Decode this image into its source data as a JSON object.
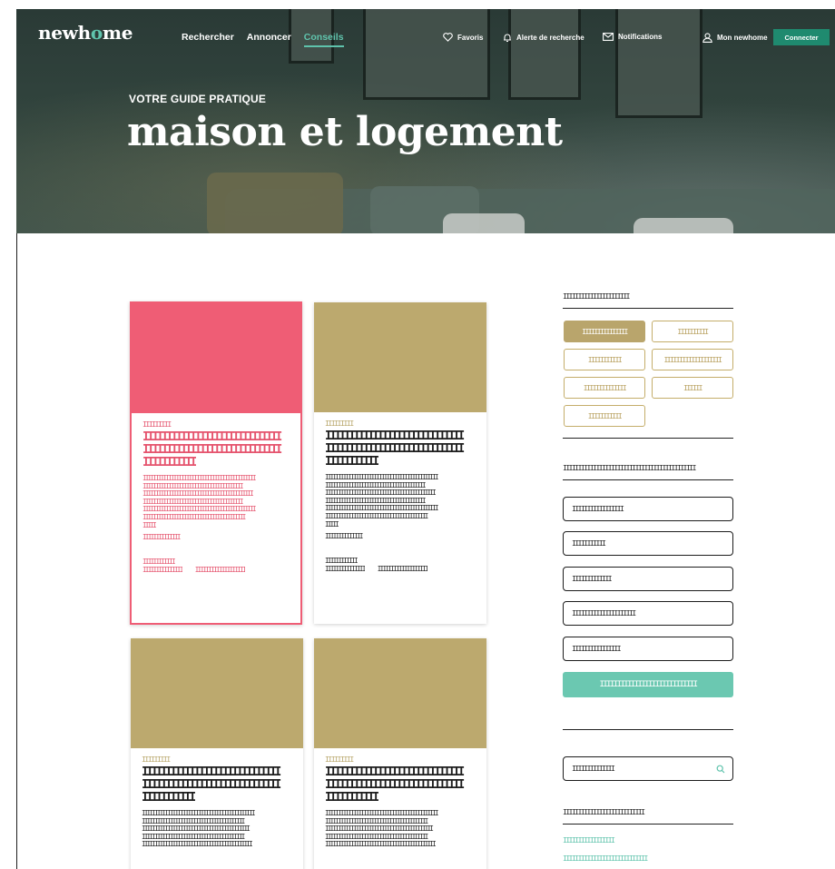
{
  "header": {
    "logo_before": "newh",
    "logo_mark": "o",
    "logo_after": "me",
    "nav": [
      "Rechercher",
      "Annoncer",
      "Conseils"
    ],
    "active_nav": "Conseils",
    "favoris": "Favoris",
    "alerte": "Alerte de recherche",
    "notifications": "Notifications",
    "account": "Mon newhome",
    "connect": "Connecter",
    "icons": {
      "favoris": "heart-icon",
      "alerte": "bell-icon",
      "notifications": "envelope-icon",
      "account": "user-icon"
    }
  },
  "hero": {
    "kicker": "VOTRE GUIDE PRATIQUE",
    "title": "maison et logement"
  },
  "cards": [
    {
      "category": "IIIIIIIII",
      "title_lines": [
        "IIIIIIIIIIIIIIIIIIIIIIIIIIIII",
        "IIIIIIIIIIIIIIIIIIIIIIIIIIIII",
        "IIIIIIIIIII"
      ],
      "excerpt_lines": [
        "IIIIIIIIIIIIIIIIIIIIIIIIIIIIIIIIIIIIIIIIIIII",
        "IIIIIIIIIIIIIIIIIIIIIIIIIIIIIIIIIIIIIII",
        "IIIIIIIIIIIIIIIIIIIIIIIIIIIIIIIIIIIIIIIIIII",
        "IIIIIIIIIIIIIIIIIIIIIIIIIIIIIIIIIIIIIII",
        "IIIIIIIIIIIIIIIIIIIIIIIIIIIIIIIIIIIIIIIIIIII",
        "IIIIIIIIIIIIIIIIIIIIIIIIIIIIIIIIIIIIIIII",
        "IIIII"
      ],
      "more": "IIIIIIIIIIIIII",
      "meta_line1": "IIIIIIIIIIII",
      "meta_date": "IIIIIIIIIIIIIII",
      "meta_read": "IIIIIIIIIIIIIIIIIII"
    },
    {
      "category": "IIIIIIIII",
      "title_lines": [
        "IIIIIIIIIIIIIIIIIIIIIIIIIIIII",
        "IIIIIIIIIIIIIIIIIIIIIIIIIIIII",
        "IIIIIIIIIII"
      ],
      "excerpt_lines": [
        "IIIIIIIIIIIIIIIIIIIIIIIIIIIIIIIIIIIIIIIIIIII",
        "IIIIIIIIIIIIIIIIIIIIIIIIIIIIIIIIIIIIIII",
        "IIIIIIIIIIIIIIIIIIIIIIIIIIIIIIIIIIIIIIIIIII",
        "IIIIIIIIIIIIIIIIIIIIIIIIIIIIIIIIIIIIIII",
        "IIIIIIIIIIIIIIIIIIIIIIIIIIIIIIIIIIIIIIIIIIII",
        "IIIIIIIIIIIIIIIIIIIIIIIIIIIIIIIIIIIIIIII",
        "IIIII"
      ],
      "more": "IIIIIIIIIIIIII",
      "meta_line1": "IIIIIIIIIIII",
      "meta_date": "IIIIIIIIIIIIIII",
      "meta_read": "IIIIIIIIIIIIIIIIIII"
    },
    {
      "category": "IIIIIIIII",
      "title_lines": [
        "IIIIIIIIIIIIIIIIIIIIIIIIIIIII",
        "IIIIIIIIIIIIIIIIIIIIIIIIIIIII",
        "IIIIIIIIIII"
      ],
      "excerpt_lines": [
        "IIIIIIIIIIIIIIIIIIIIIIIIIIIIIIIIIIIIIIIIIIII",
        "IIIIIIIIIIIIIIIIIIIIIIIIIIIIIIIIIIIIIIII",
        "IIIIIIIIIIIIIIIIIIIIIIIIIIIIIIIIIIIIIIIIII",
        "IIIIIIIIIIIIIIIIIIIIIIIIIIIIIIIIIIIIIIII",
        "IIIIIIIIIIIIIIIIIIIIIIIIIIIIIIIIIIIIIIIIIII"
      ]
    },
    {
      "category": "IIIIIIIII",
      "title_lines": [
        "IIIIIIIIIIIIIIIIIIIIIIIIIIIII",
        "IIIIIIIIIIIIIIIIIIIIIIIIIIIII",
        "IIIIIIIIIII"
      ],
      "excerpt_lines": [
        "IIIIIIIIIIIIIIIIIIIIIIIIIIIIIIIIIIIIIIIIIIII",
        "IIIIIIIIIIIIIIIIIIIIIIIIIIIIIIIIIIIIIIII",
        "IIIIIIIIIIIIIIIIIIIIIIIIIIIIIIIIIIIIIIIIII",
        "IIIIIIIIIIIIIIIIIIIIIIIIIIIIIIIIIIIIIIII",
        "IIIIIIIIIIIIIIIIIIIIIIIIIIIIIIIIIIIIIIIIIII"
      ]
    }
  ],
  "sidebar": {
    "categories_heading": "IIIIIIIIIIIIIIIIIIIIII",
    "chips": [
      "IIIIIIIIIIIIIII",
      "IIIIIIIIII",
      "IIIIIIIIIII",
      "IIIIIIIIIIIIIIIIIII",
      "IIIIIIIIIIIIII",
      "IIIIII",
      "IIIIIIIIIII"
    ],
    "newsletter_heading": "IIIIIIIIIIIIIIIIIIIIIIIIIIIIIIIIIIIIIIIIIIII",
    "fields": [
      "IIIIIIIIIIIIIIIII",
      "IIIIIIIIIII",
      "IIIIIIIIIIIII",
      "IIIIIIIIIIIIIIIIIIIII",
      "IIIIIIIIIIIIIIII"
    ],
    "submit": "IIIIIIIIIIIIIIIIIIIIIIIIIIII",
    "search_value": "IIIIIIIIIIIIII",
    "links_heading": "IIIIIIIIIIIIIIIIIIIIIIIIIII",
    "links": [
      "IIIIIIIIIIIIIIIII",
      "IIIIIIIIIIIIIIIIIIIIIIIIIIII"
    ]
  },
  "colors": {
    "accent": "#5fc3ac",
    "connect_button": "#1f8a6f",
    "pink_card": "#ef5d75",
    "gold": "#b9a56c"
  }
}
